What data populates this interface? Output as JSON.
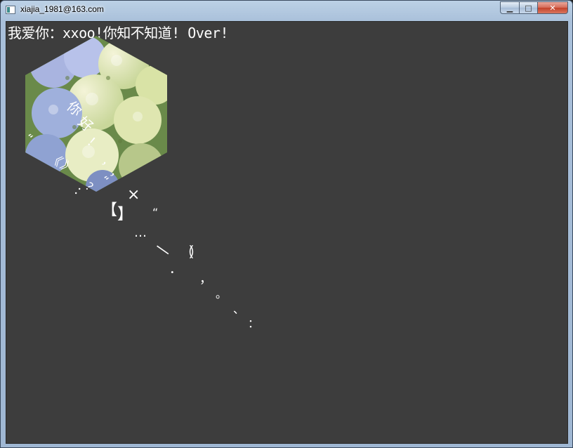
{
  "window": {
    "title": "xiajia_1981@163.com",
    "controls": {
      "minimize": "▁",
      "maximize": "□",
      "close": "✕"
    }
  },
  "content": {
    "banner_text": "我爱你：xxoo!你知不知道! Over!",
    "hexagon_image": "hydrangea-flowers",
    "floating_glyphs": [
      {
        "text": "你",
        "size": 20,
        "rot": 40
      },
      {
        "text": "好",
        "size": 20,
        "rot": 40
      },
      {
        "text": "！",
        "size": 18,
        "rot": 40
      },
      {
        "text": "，",
        "size": 16,
        "rot": 40
      },
      {
        "text": "，",
        "size": 16,
        "rot": 40
      },
      {
        "text": "“",
        "size": 16,
        "rot": 40
      },
      {
        "text": "《",
        "size": 18,
        "rot": 40
      },
      {
        "text": "》",
        "size": 18,
        "rot": 40
      },
      {
        "text": "“",
        "size": 16,
        "rot": 40
      },
      {
        "text": "？",
        "size": 16,
        "rot": 40
      },
      {
        "text": "：",
        "size": 16,
        "rot": 40
      },
      {
        "text": "×",
        "size": 22,
        "rot": 0
      },
      {
        "text": "【",
        "size": 22,
        "rot": 0
      },
      {
        "text": "】",
        "size": 22,
        "rot": 0
      },
      {
        "text": "“",
        "size": 16,
        "rot": 0
      },
      {
        "text": "…",
        "size": 18,
        "rot": 0
      },
      {
        "text": "—",
        "size": 22,
        "rot": 35
      },
      {
        "text": "（",
        "size": 20,
        "rot": 0
      },
      {
        "text": "）",
        "size": 20,
        "rot": 0
      },
      {
        "text": "．",
        "size": 18,
        "rot": 0
      },
      {
        "text": "，",
        "size": 18,
        "rot": 0
      },
      {
        "text": "。",
        "size": 16,
        "rot": 0
      },
      {
        "text": "、",
        "size": 16,
        "rot": 0
      },
      {
        "text": "：",
        "size": 16,
        "rot": 0
      }
    ]
  }
}
